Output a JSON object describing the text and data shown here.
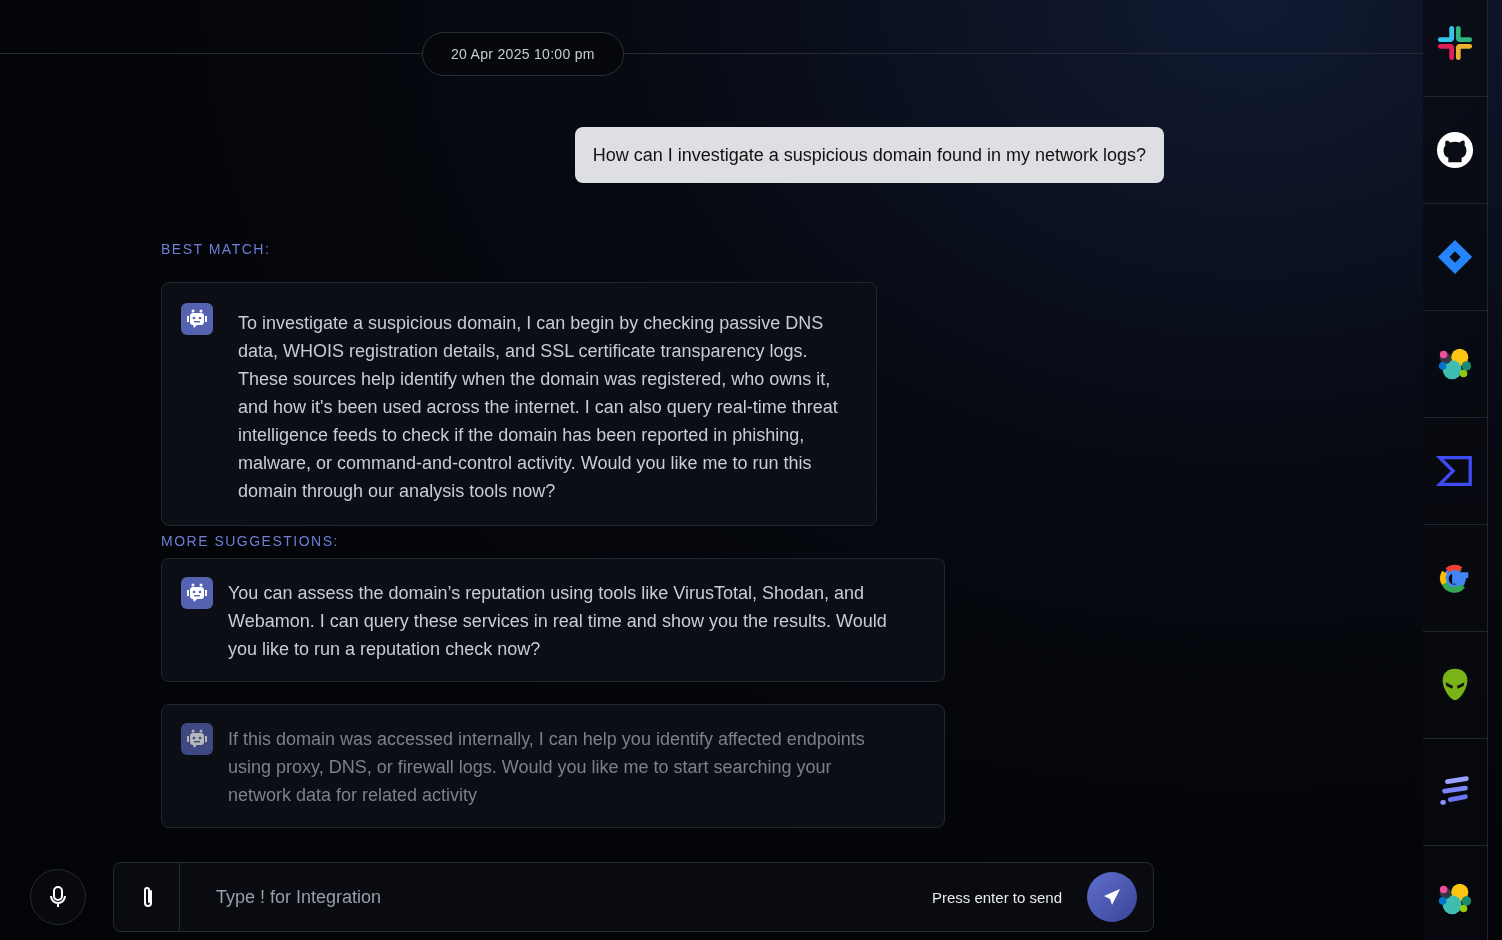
{
  "timestamp": "20 Apr 2025 10:00 pm",
  "user_message": "How can I investigate a suspicious domain found in my network logs?",
  "best_match": {
    "heading": "BEST MATCH:",
    "text": "To investigate a suspicious domain, I can begin by checking passive DNS data, WHOIS registration details, and SSL certificate transparency logs. These sources help identify when the domain was registered, who owns it, and how it's been used across the internet. I can also query real-time threat intelligence feeds to check if the domain has been reported in phishing, malware, or command-and-control activity. Would you like me to run this domain through our analysis tools now?"
  },
  "more_suggestions": {
    "heading": "MORE SUGGESTIONS:",
    "items": [
      {
        "text": "You can assess the domain’s reputation using tools like VirusTotal, Shodan, and Webamon. I can query these services in real time and show you the results. Would you like to run a reputation check now?",
        "faded": false
      },
      {
        "text": "If this domain was accessed internally, I can help you identify affected endpoints using proxy, DNS, or firewall logs. Would you like me to start searching your network data for related activity",
        "faded": true
      }
    ]
  },
  "composer": {
    "placeholder": "Type ! for Integration",
    "hint": "Press enter to send"
  },
  "sidebar": {
    "items": [
      {
        "kind": "hash"
      },
      {
        "kind": "octocat"
      },
      {
        "kind": "diamond"
      },
      {
        "kind": "blobs"
      },
      {
        "kind": "bracket"
      },
      {
        "kind": "gletter"
      },
      {
        "kind": "alien"
      },
      {
        "kind": "stripes"
      },
      {
        "kind": "blobs"
      }
    ]
  }
}
